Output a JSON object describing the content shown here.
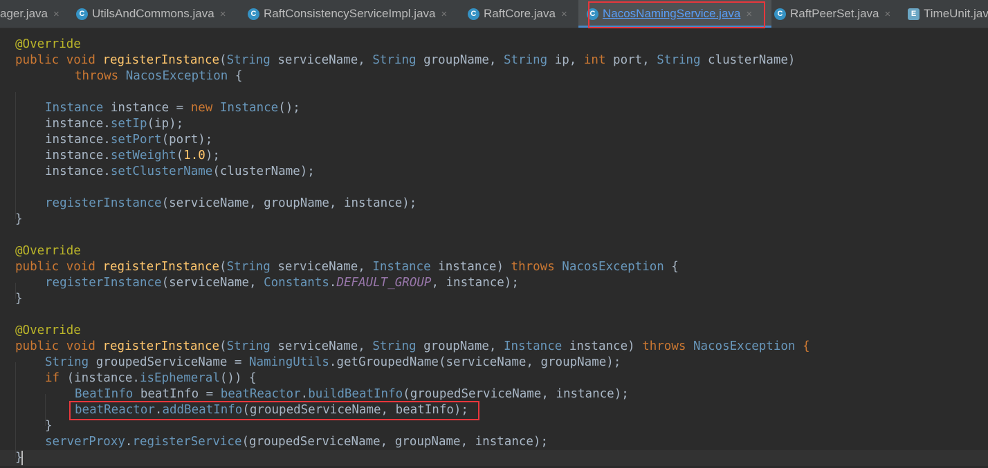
{
  "tabs": [
    {
      "label": "ager.java",
      "icon": "",
      "active": false
    },
    {
      "label": "UtilsAndCommons.java",
      "icon": "C",
      "active": false
    },
    {
      "label": "RaftConsistencyServiceImpl.java",
      "icon": "C",
      "active": false
    },
    {
      "label": "RaftCore.java",
      "icon": "C",
      "active": false
    },
    {
      "label": "NacosNamingService.java",
      "icon": "C",
      "active": true
    },
    {
      "label": "RaftPeerSet.java",
      "icon": "C",
      "active": false
    },
    {
      "label": "TimeUnit.jav",
      "icon": "E",
      "active": false
    }
  ],
  "close_glyph": "×",
  "code": {
    "l01": [
      "@Override"
    ],
    "l02": [
      "public",
      " ",
      "void",
      " ",
      "registerInstance",
      "(",
      "String",
      " serviceName, ",
      "String",
      " groupName, ",
      "String",
      " ip, ",
      "int",
      " port, ",
      "String",
      " clusterName)"
    ],
    "l03": [
      "throws",
      " ",
      "NacosException",
      " {"
    ],
    "l04": [],
    "l05": [
      "Instance",
      " instance = ",
      "new",
      " ",
      "Instance",
      "();"
    ],
    "l06": [
      "instance.",
      "setIp",
      "(ip);"
    ],
    "l07": [
      "instance.",
      "setPort",
      "(port);"
    ],
    "l08": [
      "instance.",
      "setWeight",
      "(",
      "1.0",
      ");"
    ],
    "l09": [
      "instance.",
      "setClusterName",
      "(clusterName);"
    ],
    "l10": [],
    "l11": [
      "registerInstance",
      "(serviceName, groupName, instance);"
    ],
    "l12": [
      "}"
    ],
    "l13": [],
    "l14": [
      "@Override"
    ],
    "l15": [
      "public",
      " ",
      "void",
      " ",
      "registerInstance",
      "(",
      "String",
      " serviceName, ",
      "Instance",
      " instance) ",
      "throws",
      " ",
      "NacosException",
      " {"
    ],
    "l16": [
      "registerInstance",
      "(serviceName, ",
      "Constants",
      ".",
      "DEFAULT_GROUP",
      ", instance);"
    ],
    "l17": [
      "}"
    ],
    "l18": [],
    "l19": [
      "@Override"
    ],
    "l20": [
      "public",
      " ",
      "void",
      " ",
      "registerInstance",
      "(",
      "String",
      " serviceName, ",
      "String",
      " groupName, ",
      "Instance",
      " instance) ",
      "throws",
      " ",
      "NacosException",
      " {"
    ],
    "l21": [
      "String",
      " groupedServiceName = ",
      "NamingUtils",
      ".getGroupedName(serviceName, groupName);"
    ],
    "l22": [
      "if",
      " (instance.",
      "isEphemeral",
      "()) {"
    ],
    "l23": [
      "BeatInfo",
      " beatInfo = ",
      "beatReactor",
      ".",
      "buildBeatInfo",
      "(groupedServiceName, instance);"
    ],
    "l24": [
      "beatReactor",
      ".",
      "addBeatInfo",
      "(groupedServiceName, beatInfo);"
    ],
    "l25": [
      "}"
    ],
    "l26": [
      "serverProxy",
      ".",
      "registerService",
      "(groupedServiceName, groupName, instance);"
    ],
    "l27": [
      "}"
    ]
  }
}
